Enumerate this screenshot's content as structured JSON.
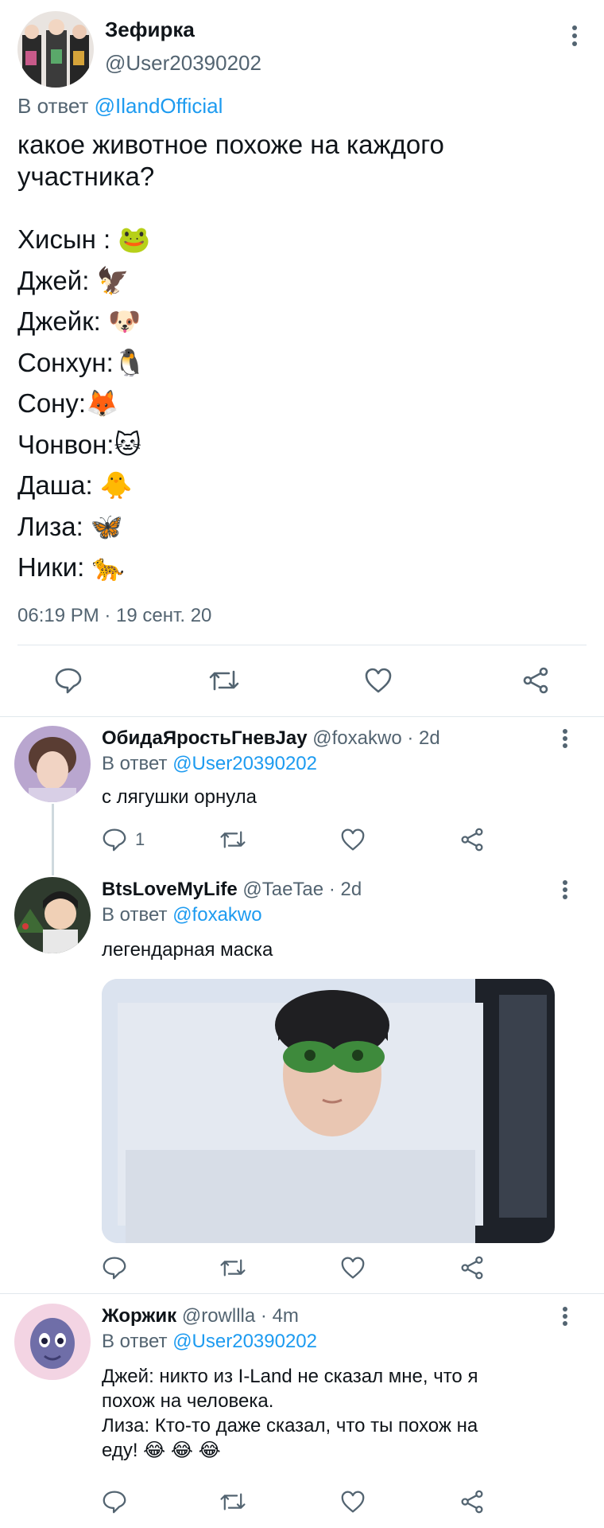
{
  "main_tweet": {
    "display_name": "Зефирка",
    "handle": "@User20390202",
    "reply_prefix": "В ответ",
    "reply_to": "@IlandOfficial",
    "text": "какое животное похоже на каждого участника?",
    "list": [
      "Хисын : 🐸",
      "Джей: 🦅",
      "Джейк: 🐶",
      "Сонхун:🐧",
      "Сону:🦊",
      "Чонвон:🐱",
      "Даша: 🐥",
      "Лиза:  🦋",
      "Ники: 🐆"
    ],
    "timestamp": "06:19 PM · 19 сент. 20"
  },
  "replies": [
    {
      "display_name": "ОбидаЯростьГневJay",
      "handle": "@foxakwo",
      "dot": "·",
      "age": "2d",
      "reply_prefix": "В ответ",
      "reply_to": "@User20390202",
      "text": "с лягушки орнула",
      "reply_count": "1"
    },
    {
      "display_name": "BtsLoveMyLife",
      "handle": "@TaeTae",
      "dot": "·",
      "age": "2d",
      "reply_prefix": "В ответ",
      "reply_to": "@foxakwo",
      "text": "легендарная маска"
    },
    {
      "display_name": "Жоржик",
      "handle": "@rowllla",
      "dot": "·",
      "age": "4m",
      "reply_prefix": "В ответ",
      "reply_to": "@User20390202",
      "text_lines": [
        "Джей: никто из I-Land не сказал мне, что я",
        "похож на человека.",
        "Лиза: Кто-то даже сказал, что ты похож на",
        "еду! 😂 😂 😂"
      ]
    }
  ],
  "icons": {
    "reply": "comment-icon",
    "retweet": "retweet-icon",
    "like": "heart-icon",
    "share": "share-icon",
    "more": "more-vertical-icon"
  },
  "colors": {
    "link": "#1d9bf0",
    "muted": "#536471",
    "separator": "#e1e8ed"
  }
}
